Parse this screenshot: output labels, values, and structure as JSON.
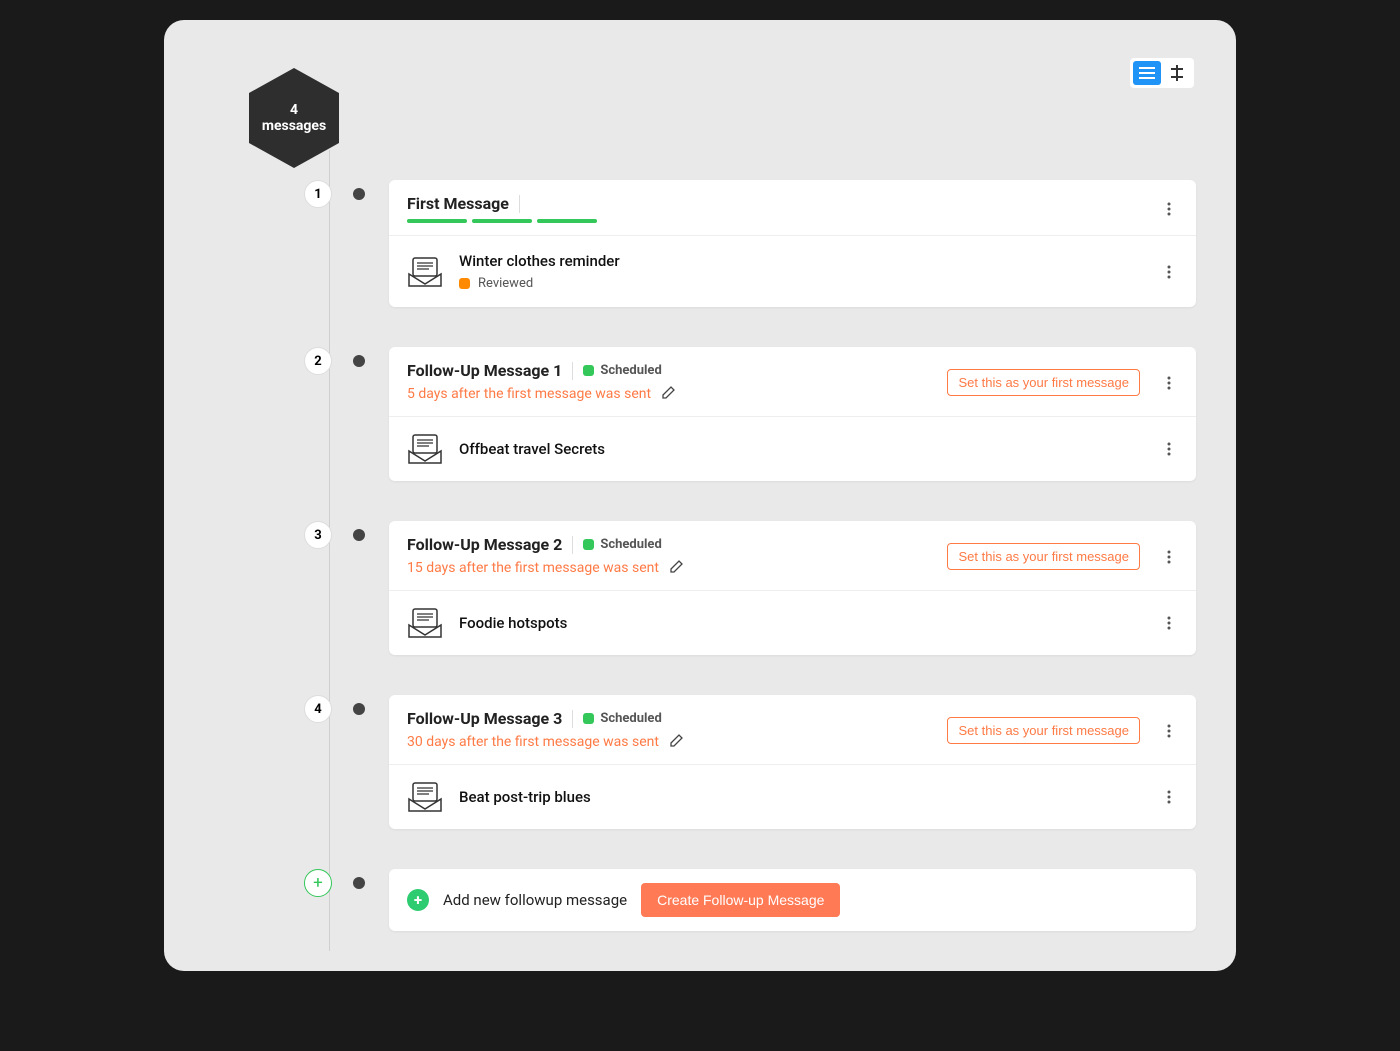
{
  "colors": {
    "accent_blue": "#1f93f6",
    "accent_orange": "#ff7a45",
    "accent_green": "#34c759"
  },
  "summary": {
    "count": "4",
    "label": "messages"
  },
  "set_first_label": "Set this as your first message",
  "steps": [
    {
      "num": "1",
      "title": "First Message",
      "status_label": null,
      "schedule_text": null,
      "progress": true,
      "set_first": false,
      "item": {
        "title": "Winter clothes reminder",
        "status": "Reviewed",
        "status_color": "orange"
      }
    },
    {
      "num": "2",
      "title": "Follow-Up Message 1",
      "status_label": "Scheduled",
      "schedule_text": "5 days after the first message was sent",
      "progress": false,
      "set_first": true,
      "item": {
        "title": "Offbeat travel Secrets",
        "status": null
      }
    },
    {
      "num": "3",
      "title": "Follow-Up Message 2",
      "status_label": "Scheduled",
      "schedule_text": "15 days after the first message was sent",
      "progress": false,
      "set_first": true,
      "item": {
        "title": "Foodie hotspots",
        "status": null
      }
    },
    {
      "num": "4",
      "title": "Follow-Up Message 3",
      "status_label": "Scheduled",
      "schedule_text": "30 days after the first message was sent",
      "progress": false,
      "set_first": true,
      "item": {
        "title": "Beat post-trip blues",
        "status": null
      }
    }
  ],
  "add_row": {
    "text": "Add new followup message",
    "button": "Create Follow-up Message"
  }
}
